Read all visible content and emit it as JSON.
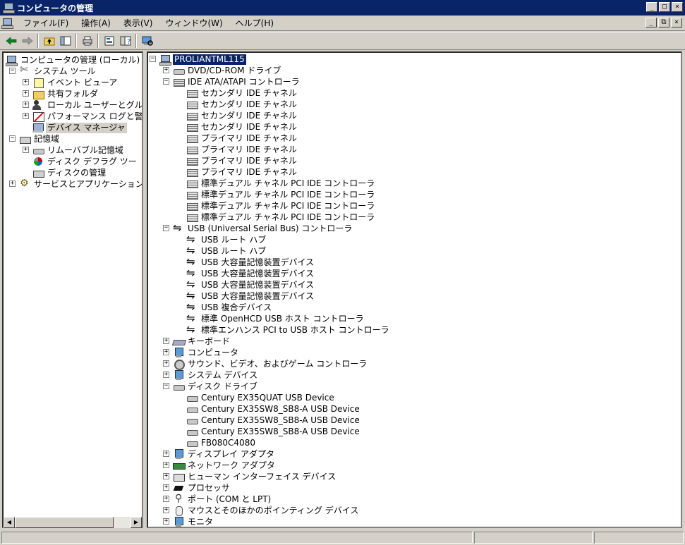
{
  "window": {
    "title": "コンピュータの管理",
    "buttons": [
      "_",
      "□",
      "×"
    ]
  },
  "menu": {
    "items": [
      "ファイル(F)",
      "操作(A)",
      "表示(V)",
      "ウィンドウ(W)",
      "ヘルプ(H)"
    ],
    "mdi_buttons": [
      "_",
      "⧉",
      "×"
    ]
  },
  "toolbar": {
    "icons": [
      "back-icon",
      "forward-icon",
      "up-folder-icon",
      "show-hide-tree-icon",
      "print-icon",
      "properties-icon",
      "help-icon",
      "scan-hardware-icon"
    ]
  },
  "left_tree": [
    {
      "label": "コンピュータの管理 (ローカル)",
      "icon": "computer",
      "depth": 0,
      "expander": ""
    },
    {
      "label": "システム ツール",
      "icon": "tools",
      "depth": 1,
      "expander": "−"
    },
    {
      "label": "イベント ビューア",
      "icon": "event",
      "depth": 2,
      "expander": "+"
    },
    {
      "label": "共有フォルダ",
      "icon": "folder",
      "depth": 2,
      "expander": "+"
    },
    {
      "label": "ローカル ユーザーとグル",
      "icon": "users",
      "depth": 2,
      "expander": "+"
    },
    {
      "label": "パフォーマンス ログと警",
      "icon": "perf",
      "depth": 2,
      "expander": "+"
    },
    {
      "label": "デバイス マネージャ",
      "icon": "devmgr",
      "depth": 2,
      "expander": "",
      "highlight": true
    },
    {
      "label": "記憶域",
      "icon": "storage",
      "depth": 1,
      "expander": "−"
    },
    {
      "label": "リムーバブル記憶域",
      "icon": "disk",
      "depth": 2,
      "expander": "+"
    },
    {
      "label": "ディスク デフラグ ツー",
      "icon": "defrag",
      "depth": 2,
      "expander": ""
    },
    {
      "label": "ディスクの管理",
      "icon": "storage",
      "depth": 2,
      "expander": ""
    },
    {
      "label": "サービスとアプリケーション",
      "icon": "svc",
      "depth": 1,
      "expander": "+"
    }
  ],
  "device_tree": [
    {
      "label": "PROLIANTML115",
      "icon": "computer",
      "depth": 0,
      "expander": "−",
      "selected": true
    },
    {
      "label": "DVD/CD-ROM ドライブ",
      "icon": "disk",
      "depth": 1,
      "expander": "+"
    },
    {
      "label": "IDE ATA/ATAPI コントローラ",
      "icon": "ide",
      "depth": 1,
      "expander": "−"
    },
    {
      "label": "セカンダリ IDE チャネル",
      "icon": "ide",
      "depth": 2,
      "expander": ""
    },
    {
      "label": "セカンダリ IDE チャネル",
      "icon": "ide",
      "depth": 2,
      "expander": ""
    },
    {
      "label": "セカンダリ IDE チャネル",
      "icon": "ide",
      "depth": 2,
      "expander": ""
    },
    {
      "label": "セカンダリ IDE チャネル",
      "icon": "ide",
      "depth": 2,
      "expander": ""
    },
    {
      "label": "プライマリ IDE チャネル",
      "icon": "ide",
      "depth": 2,
      "expander": ""
    },
    {
      "label": "プライマリ IDE チャネル",
      "icon": "ide",
      "depth": 2,
      "expander": ""
    },
    {
      "label": "プライマリ IDE チャネル",
      "icon": "ide",
      "depth": 2,
      "expander": ""
    },
    {
      "label": "プライマリ IDE チャネル",
      "icon": "ide",
      "depth": 2,
      "expander": ""
    },
    {
      "label": "標準デュアル チャネル PCI IDE コントローラ",
      "icon": "ide",
      "depth": 2,
      "expander": ""
    },
    {
      "label": "標準デュアル チャネル PCI IDE コントローラ",
      "icon": "ide",
      "depth": 2,
      "expander": ""
    },
    {
      "label": "標準デュアル チャネル PCI IDE コントローラ",
      "icon": "ide",
      "depth": 2,
      "expander": ""
    },
    {
      "label": "標準デュアル チャネル PCI IDE コントローラ",
      "icon": "ide",
      "depth": 2,
      "expander": ""
    },
    {
      "label": "USB (Universal Serial Bus) コントローラ",
      "icon": "usb",
      "depth": 1,
      "expander": "−"
    },
    {
      "label": "USB ルート ハブ",
      "icon": "usb",
      "depth": 2,
      "expander": ""
    },
    {
      "label": "USB ルート ハブ",
      "icon": "usb",
      "depth": 2,
      "expander": ""
    },
    {
      "label": "USB 大容量記憶装置デバイス",
      "icon": "usb",
      "depth": 2,
      "expander": ""
    },
    {
      "label": "USB 大容量記憶装置デバイス",
      "icon": "usb",
      "depth": 2,
      "expander": ""
    },
    {
      "label": "USB 大容量記憶装置デバイス",
      "icon": "usb",
      "depth": 2,
      "expander": ""
    },
    {
      "label": "USB 大容量記憶装置デバイス",
      "icon": "usb",
      "depth": 2,
      "expander": ""
    },
    {
      "label": "USB 複合デバイス",
      "icon": "usb",
      "depth": 2,
      "expander": ""
    },
    {
      "label": "標準 OpenHCD USB ホスト コントローラ",
      "icon": "usb",
      "depth": 2,
      "expander": ""
    },
    {
      "label": "標準エンハンス PCI to USB ホスト コントローラ",
      "icon": "usb",
      "depth": 2,
      "expander": ""
    },
    {
      "label": "キーボード",
      "icon": "kb",
      "depth": 1,
      "expander": "+"
    },
    {
      "label": "コンピュータ",
      "icon": "sys",
      "depth": 1,
      "expander": "+"
    },
    {
      "label": "サウンド、ビデオ、およびゲーム コントローラ",
      "icon": "sound",
      "depth": 1,
      "expander": "+"
    },
    {
      "label": "システム デバイス",
      "icon": "sys",
      "depth": 1,
      "expander": "+"
    },
    {
      "label": "ディスク ドライブ",
      "icon": "disk",
      "depth": 1,
      "expander": "−"
    },
    {
      "label": "Century EX35QUAT USB Device",
      "icon": "disk",
      "depth": 2,
      "expander": ""
    },
    {
      "label": "Century EX35SW8_SB8-A USB Device",
      "icon": "disk",
      "depth": 2,
      "expander": ""
    },
    {
      "label": "Century EX35SW8_SB8-A USB Device",
      "icon": "disk",
      "depth": 2,
      "expander": ""
    },
    {
      "label": "Century EX35SW8_SB8-A USB Device",
      "icon": "disk",
      "depth": 2,
      "expander": ""
    },
    {
      "label": "FB080C4080",
      "icon": "disk",
      "depth": 2,
      "expander": ""
    },
    {
      "label": "ディスプレイ アダプタ",
      "icon": "sys",
      "depth": 1,
      "expander": "+"
    },
    {
      "label": "ネットワーク アダプタ",
      "icon": "net",
      "depth": 1,
      "expander": "+"
    },
    {
      "label": "ヒューマン インターフェイス デバイス",
      "icon": "hid",
      "depth": 1,
      "expander": "+"
    },
    {
      "label": "プロセッサ",
      "icon": "cpu",
      "depth": 1,
      "expander": "+"
    },
    {
      "label": "ポート (COM と LPT)",
      "icon": "port",
      "depth": 1,
      "expander": "+"
    },
    {
      "label": "マウスとそのほかのポインティング デバイス",
      "icon": "mouse",
      "depth": 1,
      "expander": "+"
    },
    {
      "label": "モニタ",
      "icon": "sys",
      "depth": 1,
      "expander": "+"
    }
  ],
  "scrollbar": {
    "left_arrow": "◀",
    "right_arrow": "▶"
  }
}
